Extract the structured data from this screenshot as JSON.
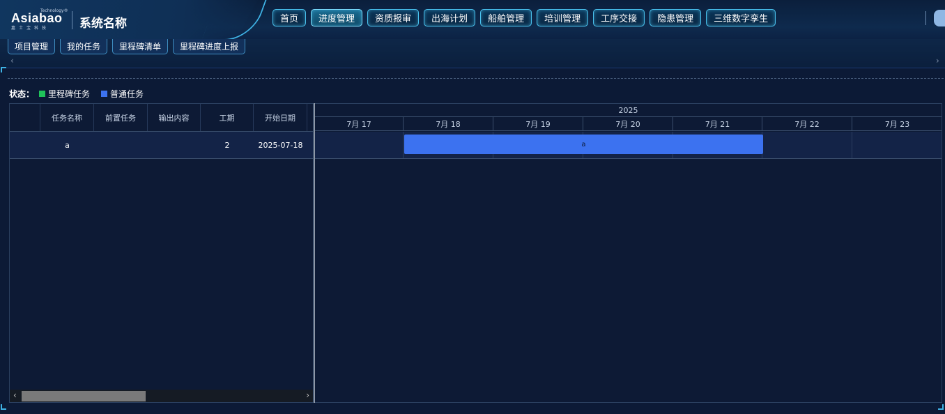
{
  "brand": {
    "logo_word": "Asiabao",
    "logo_tm": "Technology®",
    "logo_sub": "嘉士宝科技",
    "system_name": "系统名称"
  },
  "nav": {
    "items": [
      "首页",
      "进度管理",
      "资质报审",
      "出海计划",
      "船舶管理",
      "培训管理",
      "工序交接",
      "隐患管理",
      "三维数字孪生"
    ],
    "active": "进度管理"
  },
  "sub_tabs": [
    "项目管理",
    "我的任务",
    "里程碑清单",
    "里程碑进度上报"
  ],
  "legend": {
    "label": "状态：",
    "items": [
      {
        "name": "里程碑任务",
        "color": "#1fc35a"
      },
      {
        "name": "普通任务",
        "color": "#3c72f0"
      }
    ]
  },
  "grid": {
    "columns": [
      "",
      "任务名称",
      "前置任务",
      "输出内容",
      "工期",
      "开始日期"
    ],
    "rows": [
      {
        "index": "",
        "name": "a",
        "predecessor": "",
        "output": "",
        "duration": "2",
        "start": "2025-07-18"
      }
    ]
  },
  "gantt": {
    "year": "2025",
    "days": [
      "7月 17",
      "7月 18",
      "7月 19",
      "7月 20",
      "7月 21",
      "7月 22",
      "7月 23"
    ],
    "task_label": "a",
    "task_color": "#3c72f0"
  },
  "colors": {
    "accent": "#4ac3ef",
    "background": "#0c1a36"
  }
}
